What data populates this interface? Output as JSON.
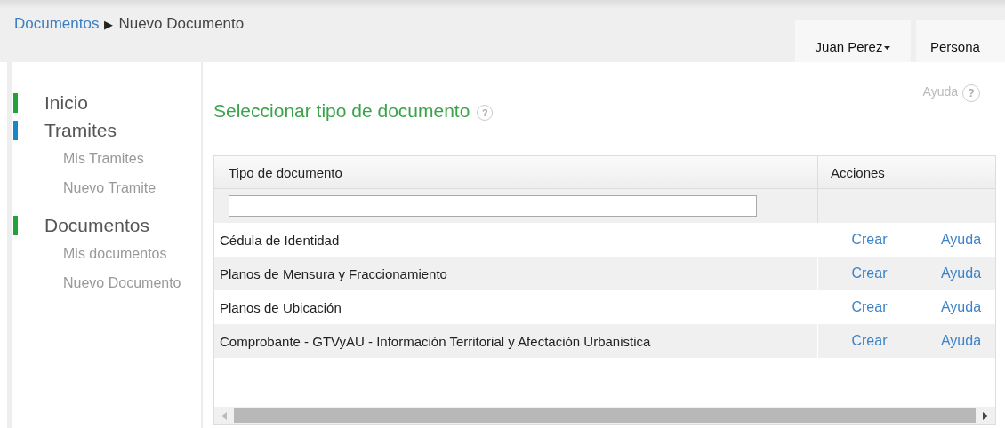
{
  "breadcrumb": {
    "items": [
      "Documentos",
      "Nuevo Documento"
    ],
    "separator": "▶"
  },
  "user_tabs": [
    {
      "label": "Juan Perez",
      "kind": "dropdown"
    },
    {
      "label": "Persona",
      "kind": "plain"
    }
  ],
  "sidebar": {
    "items": [
      {
        "label": "Inicio",
        "color": "#22a33a"
      },
      {
        "label": "Tramites",
        "color": "#1a86c8",
        "children": [
          "Mis Tramites",
          "Nuevo Tramite"
        ]
      },
      {
        "label": "Documentos",
        "color": "#22a33a",
        "children": [
          "Mis documentos",
          "Nuevo Documento"
        ]
      }
    ]
  },
  "page": {
    "title": "Seleccionar tipo de documento",
    "title_help": "?",
    "help_link": "Ayuda",
    "help_icon": "?"
  },
  "table": {
    "columns": [
      "Tipo de documento",
      "Acciones"
    ],
    "rows": [
      {
        "name": "Cédula de Identidad",
        "create": "Crear",
        "help": "Ayuda"
      },
      {
        "name": "Planos de Mensura y Fraccionamiento",
        "create": "Crear",
        "help": "Ayuda"
      },
      {
        "name": "Planos de Ubicación",
        "create": "Crear",
        "help": "Ayuda"
      },
      {
        "name": "Comprobante - GTVyAU - Información Territorial y Afectación Urbanistica",
        "create": "Crear",
        "help": "Ayuda"
      }
    ]
  }
}
